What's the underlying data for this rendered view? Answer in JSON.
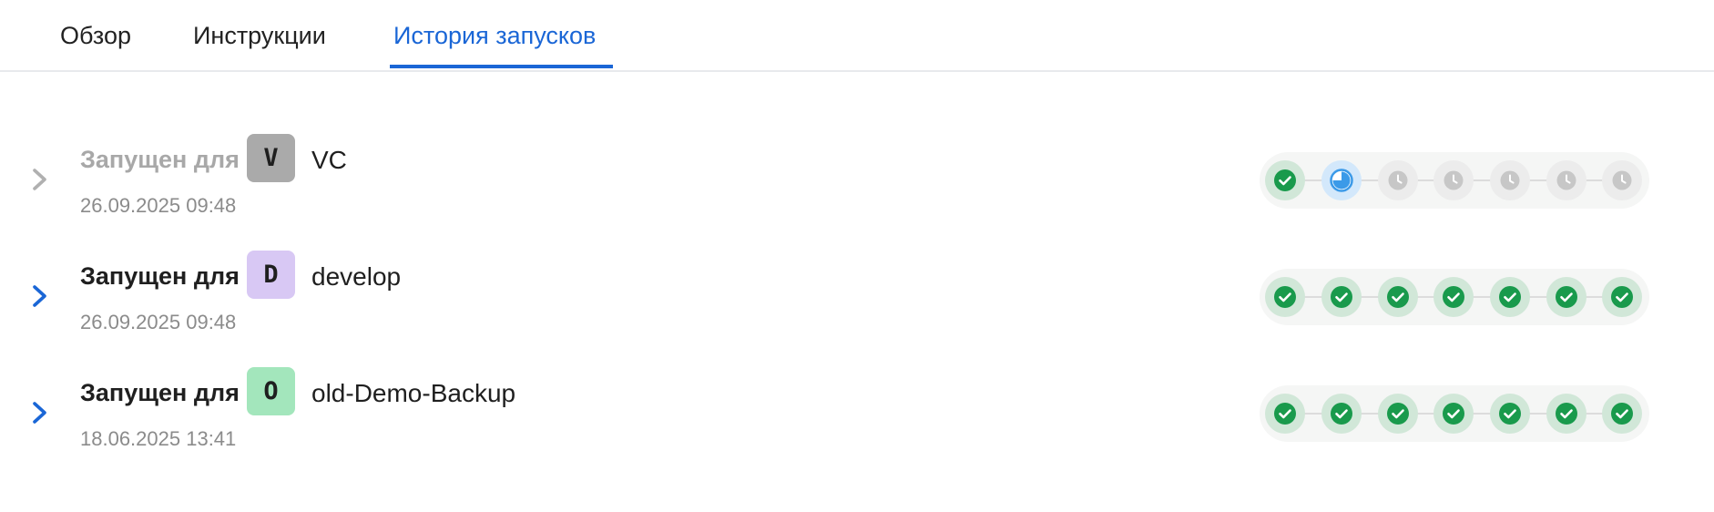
{
  "tabs": [
    {
      "label": "Обзор",
      "active": false
    },
    {
      "label": "Инструкции",
      "active": false
    },
    {
      "label": "История запусков",
      "active": true
    }
  ],
  "colors": {
    "accent": "#1a66d6",
    "success": "#199a4c",
    "running": "#3b9ae8",
    "pending": "#c7c7c7"
  },
  "runs": [
    {
      "launched_label": "Запущен для",
      "avatar_letter": "V",
      "avatar_color": "#aaaaaa",
      "branch": "VC",
      "timestamp": "26.09.2025 09:48",
      "dimmed": true,
      "stages": [
        "success-icon",
        "running-icon",
        "clock-icon",
        "clock-icon",
        "clock-icon",
        "clock-icon",
        "clock-icon"
      ]
    },
    {
      "launched_label": "Запущен для",
      "avatar_letter": "D",
      "avatar_color": "#d8c8f4",
      "branch": "develop",
      "timestamp": "26.09.2025 09:48",
      "dimmed": false,
      "stages": [
        "success-icon",
        "success-icon",
        "success-icon",
        "success-icon",
        "success-icon",
        "success-icon",
        "success-icon"
      ]
    },
    {
      "launched_label": "Запущен для",
      "avatar_letter": "O",
      "avatar_color": "#a3e6bc",
      "branch": "old-Demo-Backup",
      "timestamp": "18.06.2025 13:41",
      "dimmed": false,
      "stages": [
        "success-icon",
        "success-icon",
        "success-icon",
        "success-icon",
        "success-icon",
        "success-icon",
        "success-icon"
      ]
    }
  ]
}
